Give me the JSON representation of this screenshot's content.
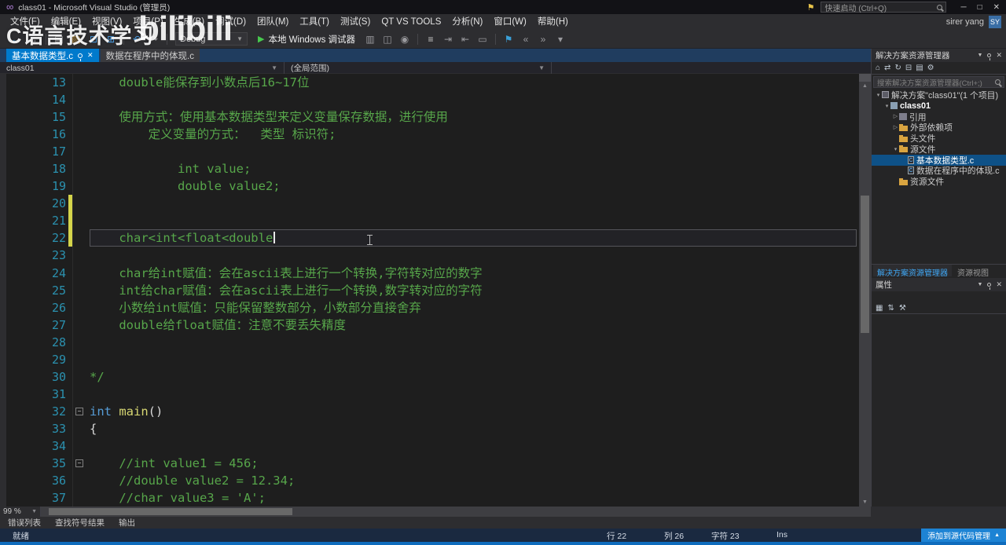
{
  "window": {
    "title": "class01 - Microsoft Visual Studio (管理员)",
    "quick_launch_placeholder": "快速启动 (Ctrl+Q)",
    "user_name": "sirer yang",
    "avatar_initials": "SY",
    "controls": {
      "minimize": "─",
      "maximize": "□",
      "close": "✕"
    }
  },
  "menu": {
    "items": [
      "文件(F)",
      "编辑(E)",
      "视图(V)",
      "项目(P)",
      "生成(B)",
      "调试(D)",
      "团队(M)",
      "工具(T)",
      "测试(S)",
      "QT VS TOOLS",
      "分析(N)",
      "窗口(W)",
      "帮助(H)"
    ]
  },
  "toolbar": {
    "items": [
      {
        "t": "icon",
        "name": "nav-backward-icon",
        "g": "←",
        "c": "#4ba0e8"
      },
      {
        "t": "icon",
        "name": "nav-forward-icon",
        "g": "→",
        "c": "#9a9a9e"
      },
      {
        "t": "sep"
      },
      {
        "t": "icon",
        "name": "new-file-icon",
        "g": "▤",
        "c": "#c8c8c8"
      },
      {
        "t": "icon",
        "name": "open-file-icon",
        "g": "▨",
        "c": "#d9a440"
      },
      {
        "t": "icon",
        "name": "save-icon",
        "g": "⊡",
        "c": "#4ba0e8"
      },
      {
        "t": "icon",
        "name": "save-all-icon",
        "g": "⊞",
        "c": "#4ba0e8"
      },
      {
        "t": "sep"
      },
      {
        "t": "icon",
        "name": "undo-icon",
        "g": "↶",
        "c": "#4ba0e8"
      },
      {
        "t": "icon",
        "name": "redo-icon",
        "g": "↷",
        "c": "#9a9a9e"
      },
      {
        "t": "sep"
      },
      {
        "t": "combo",
        "name": "solution-config-combo",
        "label": "Debug"
      },
      {
        "t": "run",
        "name": "start-debug-button",
        "label": "本地 Windows 调试器"
      },
      {
        "t": "icon",
        "name": "solution-platform-icon",
        "g": "▥",
        "c": "#9a9a9e"
      },
      {
        "t": "icon",
        "name": "attach-process-icon",
        "g": "◫",
        "c": "#9a9a9e"
      },
      {
        "t": "icon",
        "name": "breakpoint-icon",
        "g": "◉",
        "c": "#9a9a9e"
      },
      {
        "t": "sep"
      },
      {
        "t": "icon",
        "name": "find-in-files-icon",
        "g": "≡",
        "c": "#c8c8c8"
      },
      {
        "t": "icon",
        "name": "indent-icon",
        "g": "⇥",
        "c": "#9a9a9e"
      },
      {
        "t": "icon",
        "name": "outdent-icon",
        "g": "⇤",
        "c": "#9a9a9e"
      },
      {
        "t": "icon",
        "name": "comment-icon",
        "g": "▭",
        "c": "#9a9a9e"
      },
      {
        "t": "sep"
      },
      {
        "t": "icon",
        "name": "bookmark-icon",
        "g": "⚑",
        "c": "#3aa0d8"
      },
      {
        "t": "icon",
        "name": "prev-bookmark-icon",
        "g": "«",
        "c": "#9a9a9e"
      },
      {
        "t": "icon",
        "name": "next-bookmark-icon",
        "g": "»",
        "c": "#9a9a9e"
      },
      {
        "t": "icon",
        "name": "toolbar-overflow-icon",
        "g": "▾",
        "c": "#9a9a9e"
      }
    ]
  },
  "tabs": [
    {
      "label": "基本数据类型.c",
      "active": true
    },
    {
      "label": "数据在程序中的体现.c",
      "active": false
    }
  ],
  "navbar": {
    "project": "class01",
    "scope": "(全局范围)"
  },
  "editor": {
    "lines": [
      {
        "n": 13,
        "segs": [
          [
            "c",
            "    double能保存到小数点后16~17位"
          ]
        ]
      },
      {
        "n": 14,
        "segs": []
      },
      {
        "n": 15,
        "segs": [
          [
            "c",
            "    使用方式：使用基本数据类型来定义变量保存数据，进行使用"
          ]
        ]
      },
      {
        "n": 16,
        "segs": [
          [
            "c",
            "        定义变量的方式：  类型 标识符;"
          ]
        ]
      },
      {
        "n": 17,
        "segs": []
      },
      {
        "n": 18,
        "segs": [
          [
            "c",
            "            int value;"
          ]
        ]
      },
      {
        "n": 19,
        "segs": [
          [
            "c",
            "            double value2;"
          ]
        ]
      },
      {
        "n": 20,
        "segs": [],
        "chg": true
      },
      {
        "n": 21,
        "segs": [],
        "chg": true
      },
      {
        "n": 22,
        "segs": [
          [
            "c",
            "    char<int<float<double"
          ]
        ],
        "current": true,
        "caret": true,
        "chg": true
      },
      {
        "n": 23,
        "segs": []
      },
      {
        "n": 24,
        "segs": [
          [
            "c",
            "    char给int赋值：会在ascii表上进行一个转换,字符转对应的数字"
          ]
        ]
      },
      {
        "n": 25,
        "segs": [
          [
            "c",
            "    int给char赋值：会在ascii表上进行一个转换,数字转对应的字符"
          ]
        ]
      },
      {
        "n": 26,
        "segs": [
          [
            "c",
            "    小数给int赋值：只能保留整数部分，小数部分直接舍弃"
          ]
        ]
      },
      {
        "n": 27,
        "segs": [
          [
            "c",
            "    double给float赋值：注意不要丢失精度"
          ]
        ]
      },
      {
        "n": 28,
        "segs": []
      },
      {
        "n": 29,
        "segs": []
      },
      {
        "n": 30,
        "segs": [
          [
            "c",
            "*/"
          ]
        ]
      },
      {
        "n": 31,
        "segs": []
      },
      {
        "n": 32,
        "segs": [
          [
            "k",
            "int"
          ],
          [
            "p",
            " "
          ],
          [
            "f",
            "main"
          ],
          [
            "p",
            "()"
          ]
        ],
        "fold": true
      },
      {
        "n": 33,
        "segs": [
          [
            "p",
            "{"
          ]
        ]
      },
      {
        "n": 34,
        "segs": []
      },
      {
        "n": 35,
        "segs": [
          [
            "c",
            "    //int value1 = 456;"
          ]
        ],
        "fold": true
      },
      {
        "n": 36,
        "segs": [
          [
            "c",
            "    //double value2 = 12.34;"
          ]
        ]
      },
      {
        "n": 37,
        "segs": [
          [
            "c",
            "    //char value3 = 'A';"
          ]
        ]
      }
    ]
  },
  "solution_explorer": {
    "title": "解决方案资源管理器",
    "search_placeholder": "搜索解决方案资源管理器(Ctrl+;)",
    "toolbar_icons": [
      {
        "g": "⌂",
        "name": "home-icon"
      },
      {
        "g": "⇄",
        "name": "switch-views-icon"
      },
      {
        "g": "↻",
        "name": "refresh-icon"
      },
      {
        "g": "⊟",
        "name": "collapse-all-icon"
      },
      {
        "g": "▤",
        "name": "show-all-files-icon"
      },
      {
        "g": "⚙",
        "name": "properties-icon"
      }
    ],
    "tree": [
      {
        "lvl": 0,
        "arrow": "▾",
        "icon": "solution",
        "label": "解决方案\"class01\"(1 个项目)"
      },
      {
        "lvl": 1,
        "arrow": "▾",
        "icon": "project",
        "label": "class01",
        "bold": true
      },
      {
        "lvl": 2,
        "arrow": "▷",
        "icon": "refs",
        "label": "引用"
      },
      {
        "lvl": 2,
        "arrow": "▷",
        "icon": "folder",
        "label": "外部依赖项"
      },
      {
        "lvl": 2,
        "arrow": "",
        "icon": "folder",
        "label": "头文件"
      },
      {
        "lvl": 2,
        "arrow": "▾",
        "icon": "folder",
        "label": "源文件"
      },
      {
        "lvl": 3,
        "arrow": "",
        "icon": "cfile",
        "label": "基本数据类型.c",
        "selected": true
      },
      {
        "lvl": 3,
        "arrow": "",
        "icon": "cfile",
        "label": "数据在程序中的体现.c"
      },
      {
        "lvl": 2,
        "arrow": "",
        "icon": "folder",
        "label": "资源文件"
      }
    ],
    "bottom_tabs": [
      {
        "label": "解决方案资源管理器",
        "active": true
      },
      {
        "label": "资源视图",
        "active": false
      }
    ]
  },
  "properties": {
    "title": "属性",
    "toolbar_icons": [
      {
        "g": "▦",
        "name": "categorized-icon"
      },
      {
        "g": "⇅",
        "name": "alphabetical-icon"
      },
      {
        "g": "⚒",
        "name": "property-pages-icon"
      }
    ]
  },
  "bottom_panel": {
    "zoom": "99 %",
    "tabs": [
      "错误列表",
      "查找符号结果",
      "输出"
    ]
  },
  "status_bar": {
    "ready": "就绪",
    "line": "行 22",
    "col": "列 26",
    "char": "字符 23",
    "mode": "Ins",
    "source_control": "添加到源代码管理"
  },
  "watermarks": {
    "left": "C语言技术学习",
    "logo": "bilibili"
  },
  "colors": {
    "accent": "#007acc",
    "editor_bg": "#1e1e1e",
    "comment": "#57a64a",
    "keyword": "#569cd6",
    "function": "#d8d873",
    "line_number": "#2b91af",
    "tab_active": "#007acc",
    "selection": "#0e5187",
    "change_bar": "#d4d44a"
  }
}
